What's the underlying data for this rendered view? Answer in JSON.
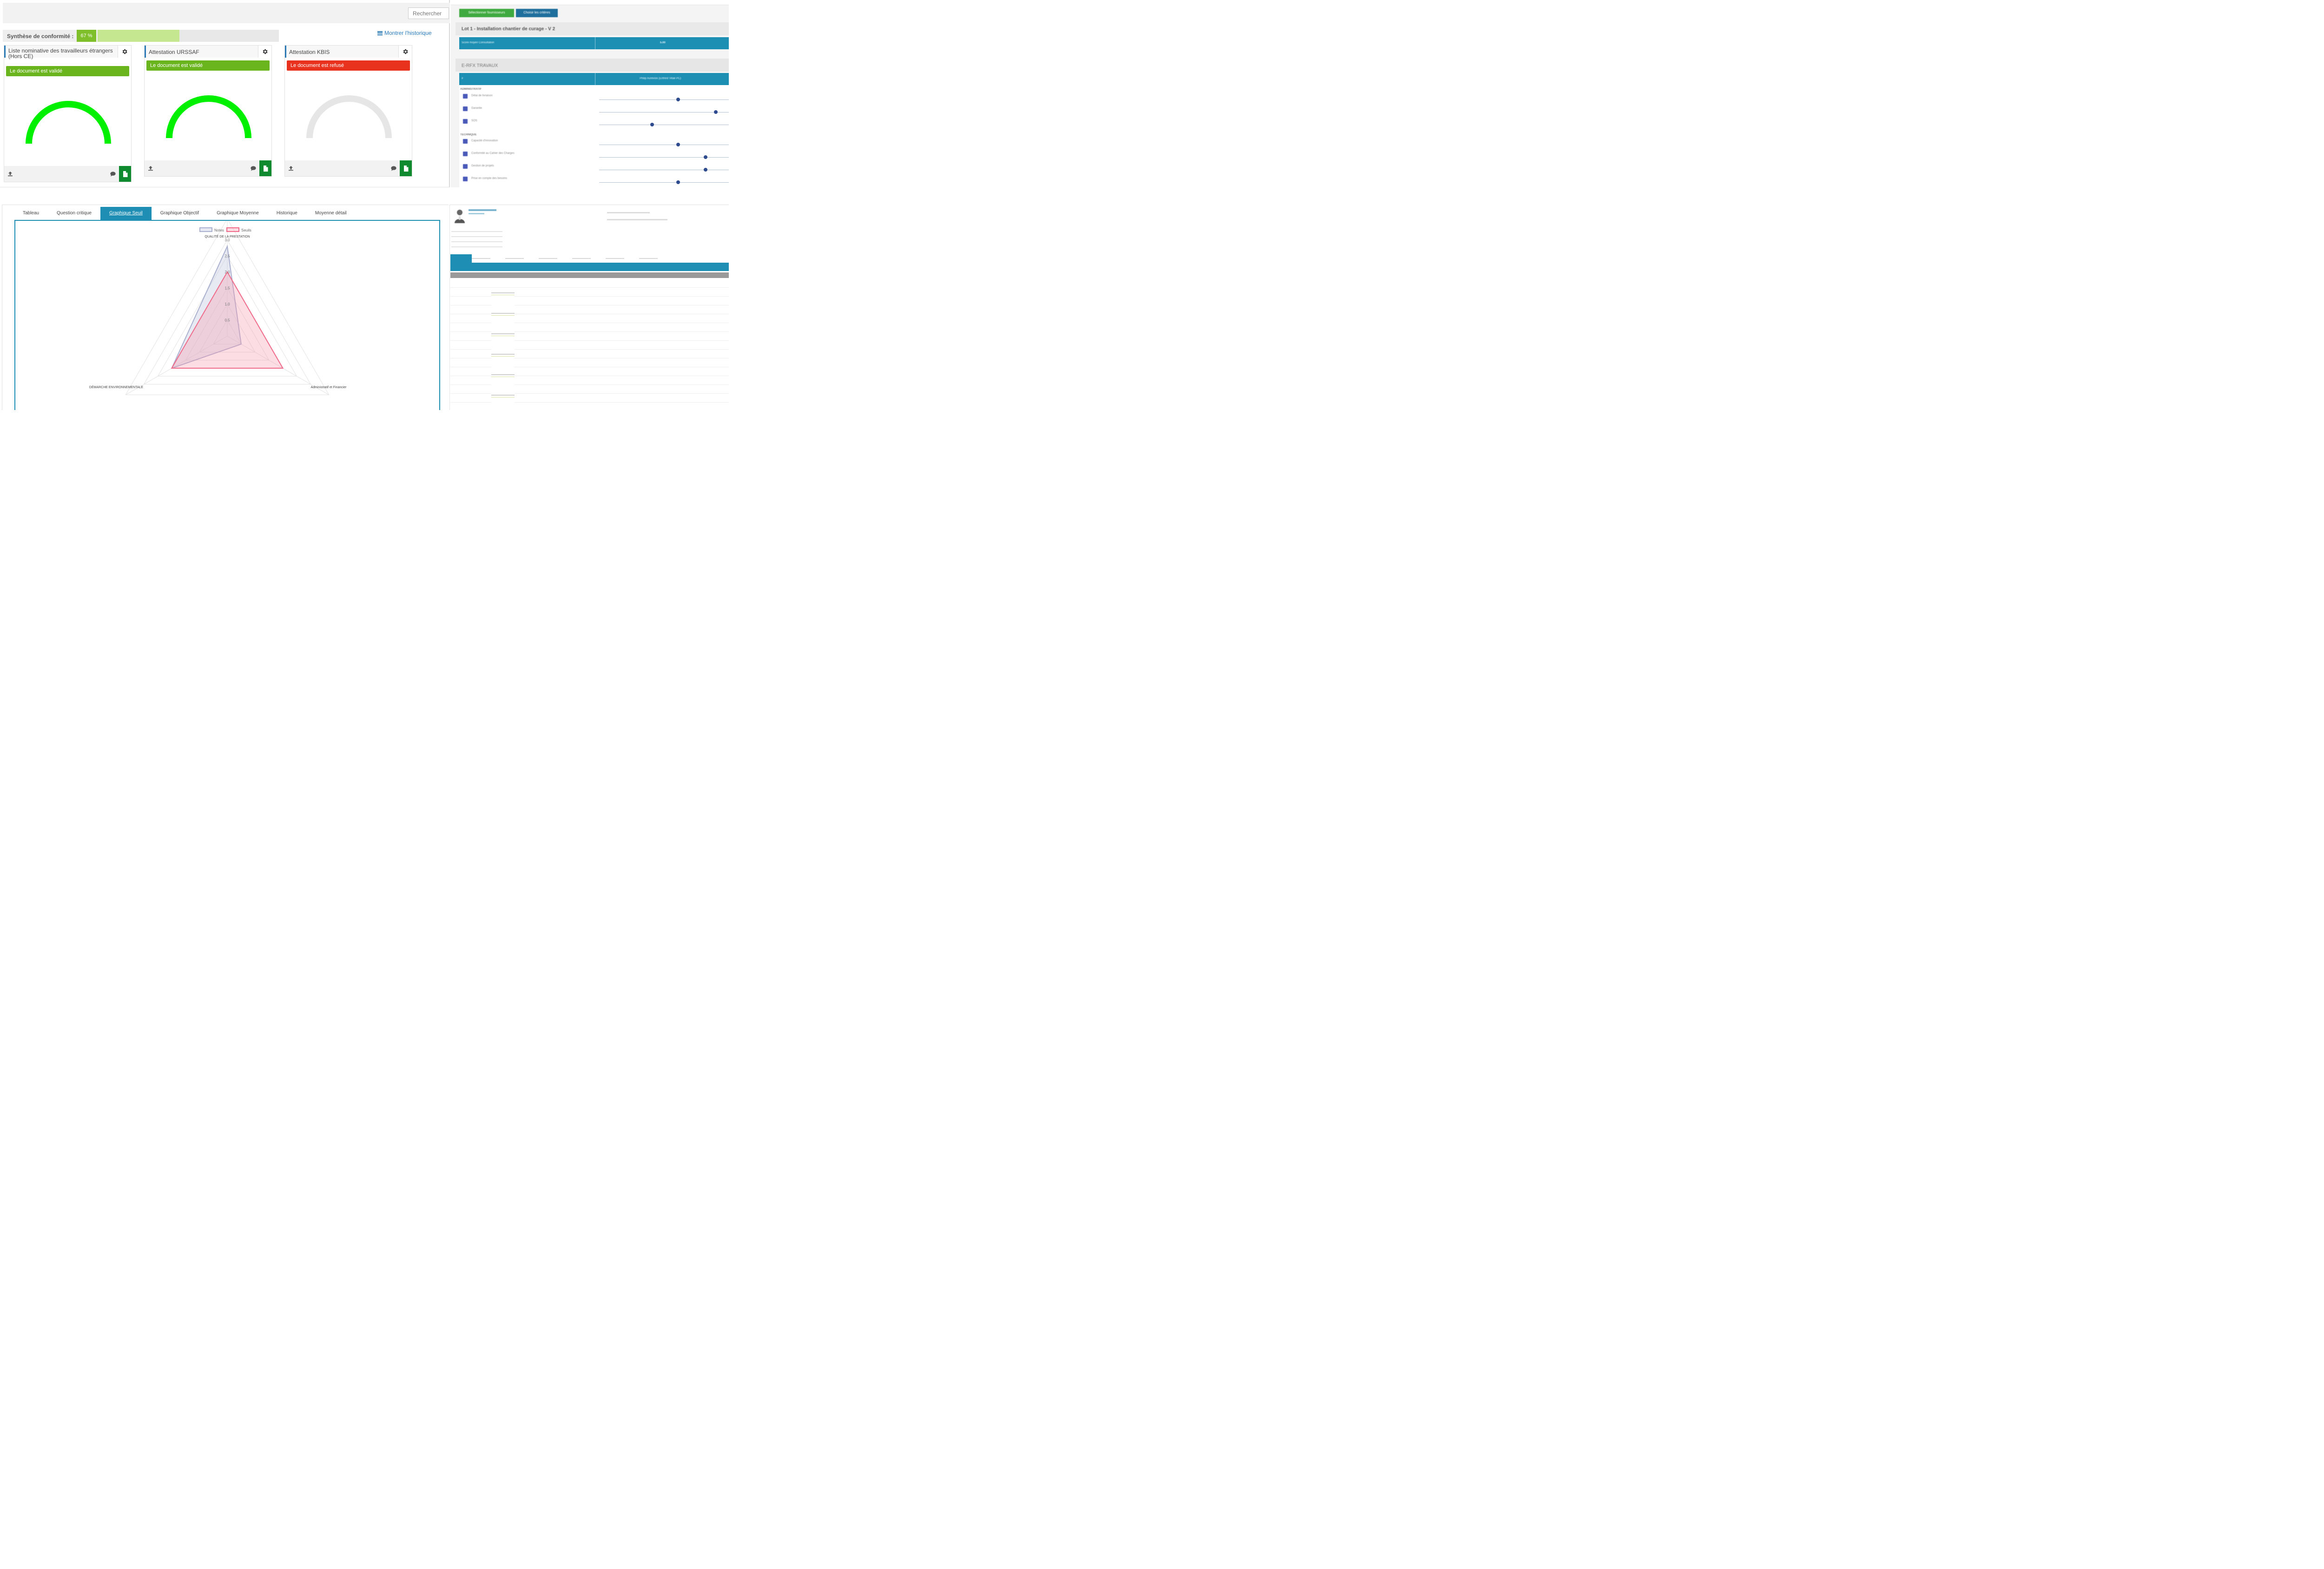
{
  "compliance": {
    "search_placeholder": "Rechercher",
    "synthesis_label": "Synthèse de conformité :",
    "synthesis_percent_label": "67 %",
    "synthesis_percent": 67,
    "history_link": "Montrer l'historique",
    "cards": [
      {
        "title": "Liste nominative des travailleurs étrangers (Hors CE)",
        "status": "Le document est validé",
        "status_color": "#6ab51e",
        "gauge_color": "#00f000",
        "gauge_value": 1.0
      },
      {
        "title": "Attestation URSSAF",
        "status": "Le document est validé",
        "status_color": "#6ab51e",
        "gauge_color": "#00f000",
        "gauge_value": 1.0
      },
      {
        "title": "Attestation KBIS",
        "status": "Le document est refusé",
        "status_color": "#e8321e",
        "gauge_color": "#e6e6e6",
        "gauge_value": 0.0
      }
    ],
    "icons": [
      "gear-icon",
      "upload-icon",
      "comment-icon",
      "document-icon"
    ]
  },
  "evaluation": {
    "select_suppliers_button": "Sélectionner fournisseurs",
    "choose_criteria_button": "Choisir les critères",
    "lot_title": "Lot 1 - Installation chantier de curage - V 2",
    "score_label": "Score moyen Consultation",
    "score_value": "5.00",
    "erfx_title": "E-RFX TRAVAUX",
    "column_hash": "#",
    "supplier_column": "Philip Aurevoix (Enfrest Vitae PC)",
    "sections": [
      {
        "name": "ADMINISTRATIF",
        "criteria": [
          {
            "label": "Délai de livraison",
            "value": 0.61
          },
          {
            "label": "Garantie",
            "value": 0.9
          },
          {
            "label": "SOS",
            "value": 0.41
          }
        ]
      },
      {
        "name": "TECHNIQUE",
        "criteria": [
          {
            "label": "Capacité d'innovation",
            "value": 0.61
          },
          {
            "label": "Conformité au Cahier des Charges",
            "value": 0.82
          },
          {
            "label": "Gestion de projets",
            "value": 0.82
          },
          {
            "label": "Prise en compte des besoins",
            "value": 0.61
          }
        ]
      }
    ]
  },
  "radar": {
    "tabs": [
      "Tableau",
      "Question critique",
      "Graphique Seuil",
      "Graphique Objectif",
      "Graphique Moyenne",
      "Historique",
      "Moyenne détail"
    ],
    "active_tab": 2,
    "colors": {
      "notes": "#aab0cf",
      "seuils": "#f06a8a"
    }
  },
  "chart_data": {
    "type": "radar",
    "axes": [
      "QUALITÉ DE LA PRESTATION",
      "Administratif et Financier",
      "DÉMARCHE ENVIRONNEMENTALE"
    ],
    "ticks": [
      "0.5",
      "1.0",
      "1.5",
      "2.0",
      "2.5",
      "3.0"
    ],
    "rlim": [
      0,
      3
    ],
    "legend_position": "top",
    "series": [
      {
        "name": "Notes",
        "values": [
          2.8,
          0.5,
          2.0
        ]
      },
      {
        "name": "Seuils",
        "values": [
          2.0,
          2.0,
          2.0
        ]
      }
    ]
  }
}
